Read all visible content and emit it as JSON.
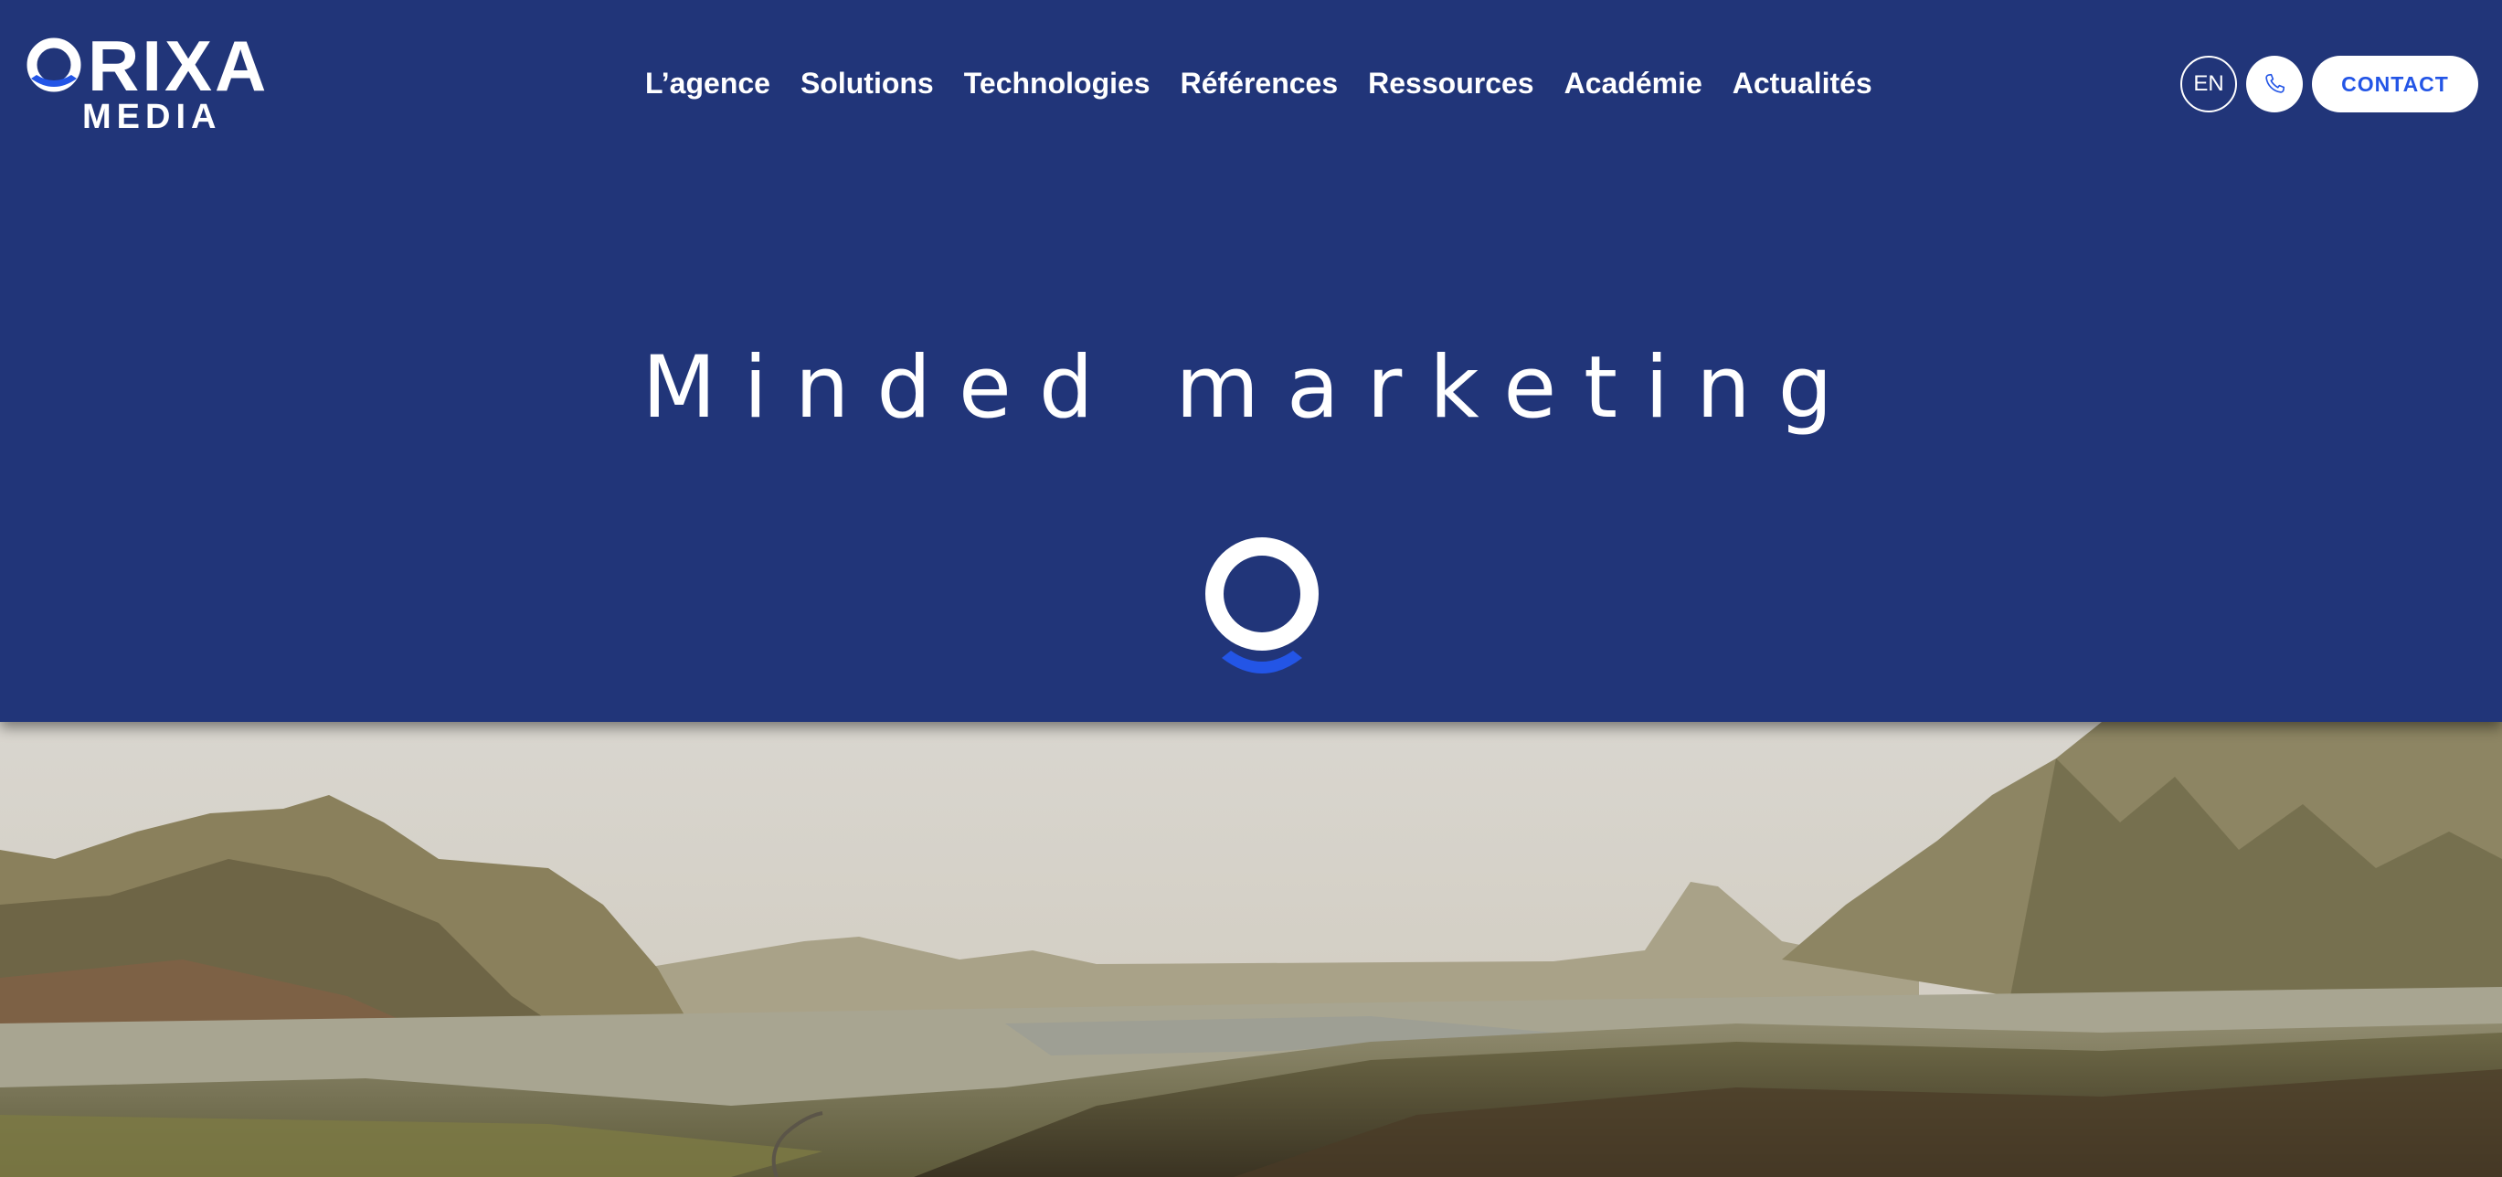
{
  "brand": {
    "logo_word": "RIXA",
    "logo_sub": "MEDIA",
    "colors": {
      "background": "#213579",
      "accent": "#2355e6",
      "white": "#ffffff"
    }
  },
  "nav": {
    "items": [
      {
        "label": "L’agence"
      },
      {
        "label": "Solutions"
      },
      {
        "label": "Technologies"
      },
      {
        "label": "Références"
      },
      {
        "label": "Ressources"
      },
      {
        "label": "Académie"
      },
      {
        "label": "Actualités"
      }
    ]
  },
  "actions": {
    "lang_label": "EN",
    "phone_icon": "phone-icon",
    "contact_label": "CONTACT"
  },
  "hero": {
    "title": "Minded marketing",
    "mark_icon": "orixa-o-icon",
    "image": "mountain-landscape"
  }
}
